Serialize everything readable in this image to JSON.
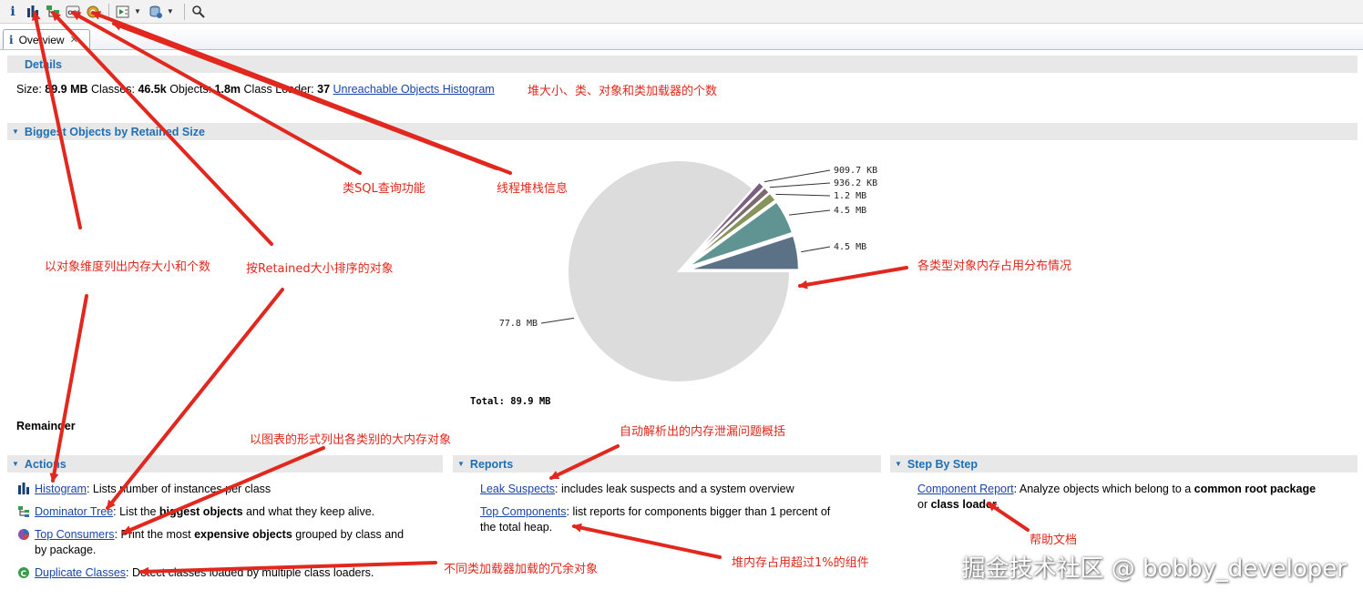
{
  "toolbar": {
    "items": [
      "overview-info",
      "histogram",
      "dominator-tree",
      "oql",
      "heap-dump-details",
      "run-report",
      "query-browser",
      "search"
    ]
  },
  "tab": {
    "label": "Overview"
  },
  "details": {
    "title": "Details",
    "size_label": "Size:",
    "size_value": "89.9 MB",
    "classes_label": "Classes:",
    "classes_value": "46.5k",
    "objects_label": "Objects:",
    "objects_value": "1.8m",
    "classloader_label": "Class Loader:",
    "classloader_value": "37",
    "unreachable_link": "Unreachable Objects Histogram"
  },
  "biggest": {
    "title": "Biggest Objects by Retained Size",
    "total": "Total:  89.9 MB",
    "remainder": "Remainder"
  },
  "chart_data": {
    "type": "pie",
    "slices": [
      {
        "label": "4.5 MB",
        "value": 4.5,
        "color": "#5a7186"
      },
      {
        "label": "4.5 MB",
        "value": 4.5,
        "color": "#5f9492"
      },
      {
        "label": "1.2 MB",
        "value": 1.2,
        "color": "#86935a"
      },
      {
        "label": "936.2 KB",
        "value": 0.914,
        "color": "#7c6a70"
      },
      {
        "label": "909.7 KB",
        "value": 0.888,
        "color": "#7d5d84"
      },
      {
        "label": "77.8 MB",
        "value": 77.8,
        "color": "#dcdcdc"
      }
    ],
    "total_label": "Total:  89.9 MB"
  },
  "actions": {
    "title": "Actions",
    "items": [
      {
        "link": "Histogram",
        "desc": ": Lists number of instances per class"
      },
      {
        "link": "Dominator Tree",
        "desc_pre": ": List the ",
        "desc_bold": "biggest objects",
        "desc_post": " and what they keep alive."
      },
      {
        "link": "Top Consumers",
        "desc_pre": ": Print the most ",
        "desc_bold": "expensive objects",
        "desc_post": " grouped by class and",
        "desc_line2": "by package."
      },
      {
        "link": "Duplicate Classes",
        "desc": ": Detect classes loaded by multiple class loaders."
      }
    ]
  },
  "reports": {
    "title": "Reports",
    "items": [
      {
        "link": "Leak Suspects",
        "desc": ": includes leak suspects and a system overview"
      },
      {
        "link": "Top Components",
        "desc": ": list reports for components bigger than 1 percent of",
        "desc_line2": "the total heap."
      }
    ]
  },
  "steps": {
    "title": "Step By Step",
    "link": "Component Report",
    "desc_pre": ": Analyze objects which belong to a ",
    "desc_bold1": "common root package",
    "desc_mid": "or ",
    "desc_bold2": "class loader",
    "desc_post": "."
  },
  "annotations": {
    "a1": "堆大小、类、对象和类加载器的个数",
    "a2": "类SQL查询功能",
    "a3": "线程堆栈信息",
    "a4": "以对象维度列出内存大小和个数",
    "a5": "按Retained大小排序的对象",
    "a6": "各类型对象内存占用分布情况",
    "a7": "以图表的形式列出各类别的大内存对象",
    "a8": "自动解析出的内存泄漏问题概括",
    "a9": "帮助文档",
    "a10": "不同类加载器加载的冗余对象",
    "a11": "堆内存占用超过1%的组件"
  },
  "watermark": "掘金技术社区 @ bobby_developer",
  "colors": {
    "annotation": "#e2281e",
    "link": "#1a44a8",
    "section_title": "#1f6fb5"
  }
}
